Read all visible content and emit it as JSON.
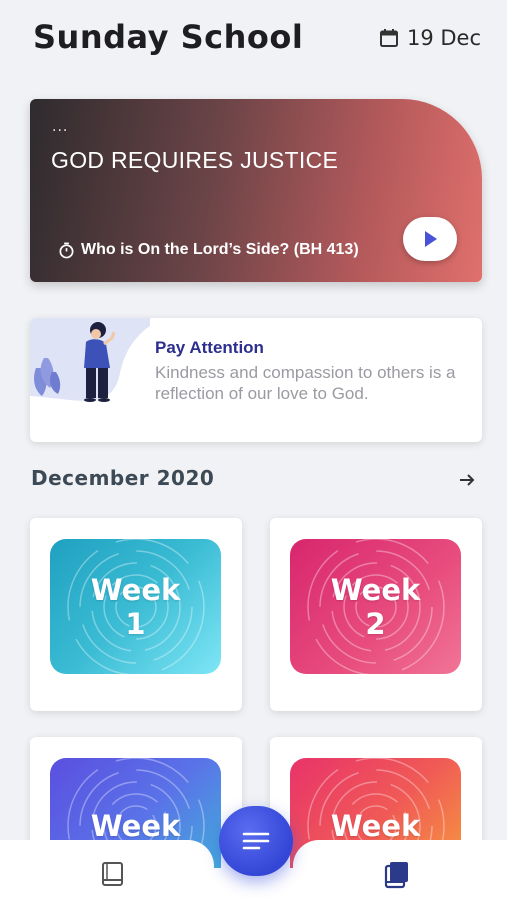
{
  "header": {
    "title": "Sunday School",
    "date": "19 Dec",
    "date_icon": "calendar-icon"
  },
  "hero": {
    "dots": "...",
    "title": "GOD REQUIRES JUSTICE",
    "hymn": "Who is On the Lord’s Side?  (BH 413)",
    "hymn_icon": "timer-icon",
    "play_icon": "play-icon",
    "colors": {
      "start": "#2e2b2e",
      "end": "#e0706c",
      "play": "#4a52d8"
    }
  },
  "attention": {
    "title": "Pay Attention",
    "text": "Kindness and compassion to others is a reflection of our love to God.",
    "title_color": "#2c2f8e"
  },
  "month": {
    "title": "December 2020",
    "arrow_icon": "arrow-right-icon"
  },
  "weeks": [
    {
      "line1": "Week",
      "line2": "1"
    },
    {
      "line1": "Week",
      "line2": "2"
    },
    {
      "line1": "Week",
      "line2": ""
    },
    {
      "line1": "Week",
      "line2": ""
    }
  ],
  "bottom_nav": {
    "left_icon": "book-icon",
    "right_icon": "books-icon",
    "fab_icon": "menu-icon",
    "accent": "#3346d6"
  }
}
